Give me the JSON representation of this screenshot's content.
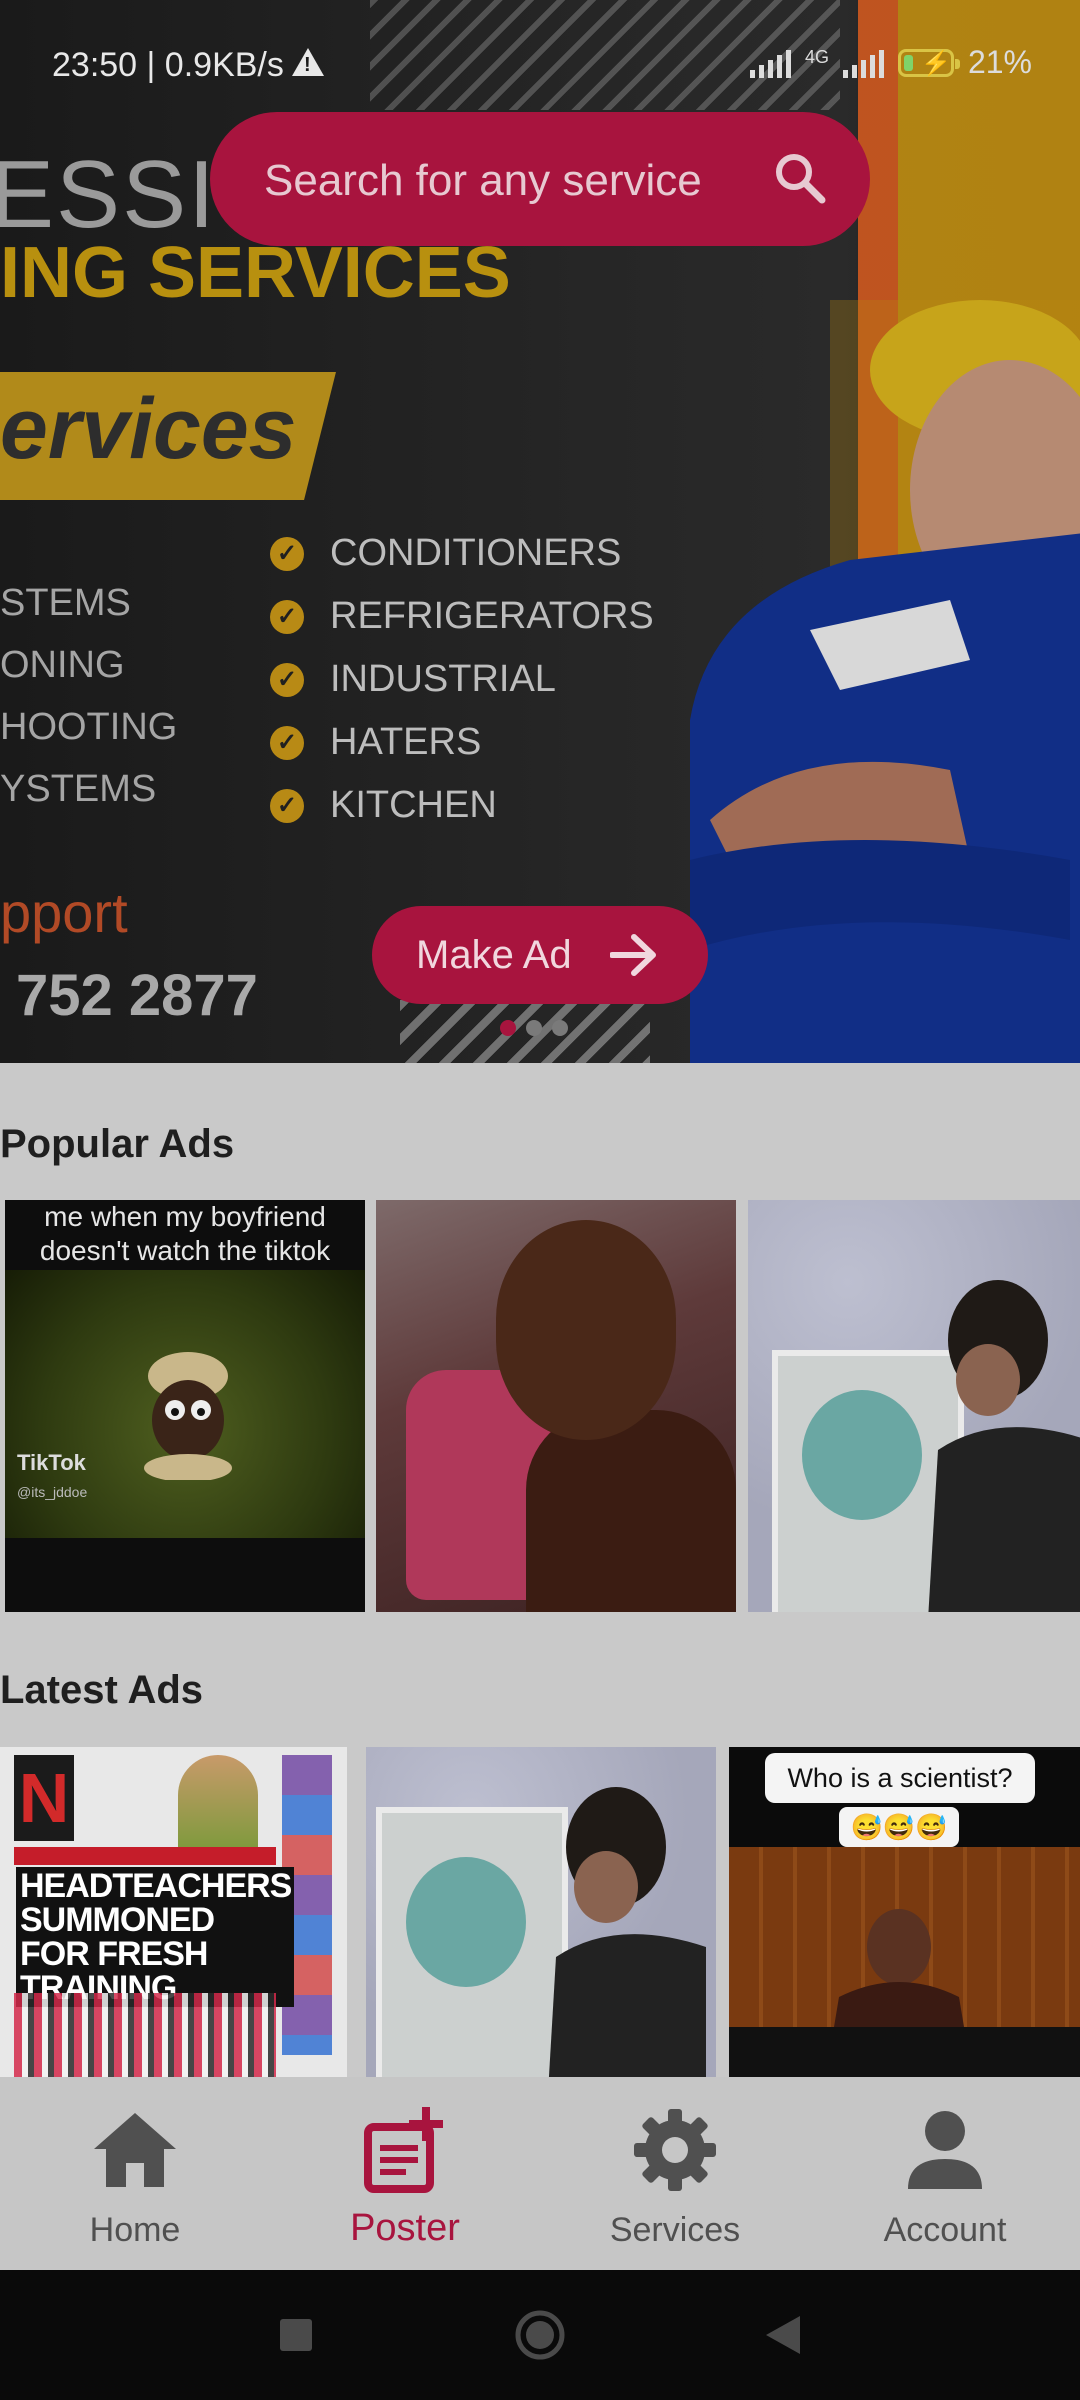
{
  "status_bar": {
    "time_speed": "23:50 | 0.9KB/s",
    "network": "4G",
    "battery": "21%",
    "battery_fraction": 0.21
  },
  "search": {
    "placeholder": "Search for any service"
  },
  "hero": {
    "heading_line1": "ESSIONAL",
    "heading_line2": "ING SERVICES",
    "ribbon": "ervices",
    "left_items": [
      "STEMS",
      "ONING",
      "HOOTING",
      "YSTEMS"
    ],
    "check_items": [
      "CONDITIONERS",
      "REFRIGERATORS",
      "INDUSTRIAL",
      "HATERS",
      "KITCHEN"
    ],
    "support": "pport",
    "phone": "752  2877",
    "make_ad_label": "Make Ad",
    "carousel": {
      "count": 3,
      "active": 0
    }
  },
  "popular": {
    "title": "Popular Ads",
    "items": [
      {
        "caption": "me when my boyfriend doesn't watch the tiktok videos i sent him",
        "tiktok": "TikTok",
        "handle": "@its_jddoe"
      },
      {
        "caption": ""
      },
      {
        "caption": ""
      }
    ]
  },
  "latest": {
    "title": "Latest Ads",
    "items": [
      {
        "logo": "N",
        "headline": "HEADTEACHERS SUMMONED FOR FRESH TRAINING"
      },
      {
        "caption": ""
      },
      {
        "bubble": "Who is a scientist?",
        "emojis": "😅😅😅"
      }
    ]
  },
  "bottom_nav": {
    "active": "poster",
    "items": [
      {
        "id": "home",
        "label": "Home",
        "icon": "home-icon"
      },
      {
        "id": "poster",
        "label": "Poster",
        "icon": "post-add-icon"
      },
      {
        "id": "services",
        "label": "Services",
        "icon": "gear-icon"
      },
      {
        "id": "account",
        "label": "Account",
        "icon": "person-icon"
      }
    ]
  },
  "colors": {
    "accent": "#a8143e",
    "background": "#c9c9c9",
    "nav_inactive": "#505050"
  }
}
